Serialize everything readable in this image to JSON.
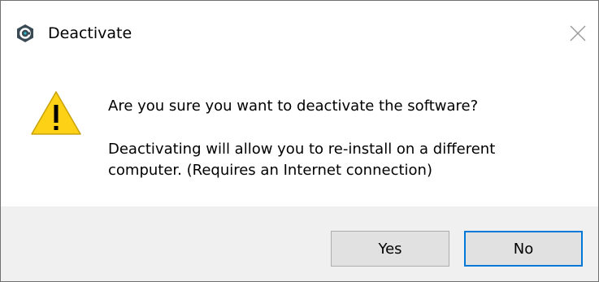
{
  "window": {
    "title": "Deactivate",
    "app_icon": "app-logo-icon",
    "close_icon": "close-icon"
  },
  "message": {
    "icon": "warning-icon",
    "question": "Are you sure you want to deactivate the software?",
    "detail_line1": "Deactivating will allow you to re-install on a different",
    "detail_line2": "computer. (Requires an Internet connection)"
  },
  "buttons": {
    "yes_label": "Yes",
    "no_label": "No"
  },
  "colors": {
    "accent": "#0078d7",
    "warning": "#fcd116",
    "app_icon_dark": "#3a4a55",
    "app_icon_accent": "#2bb7c7"
  }
}
